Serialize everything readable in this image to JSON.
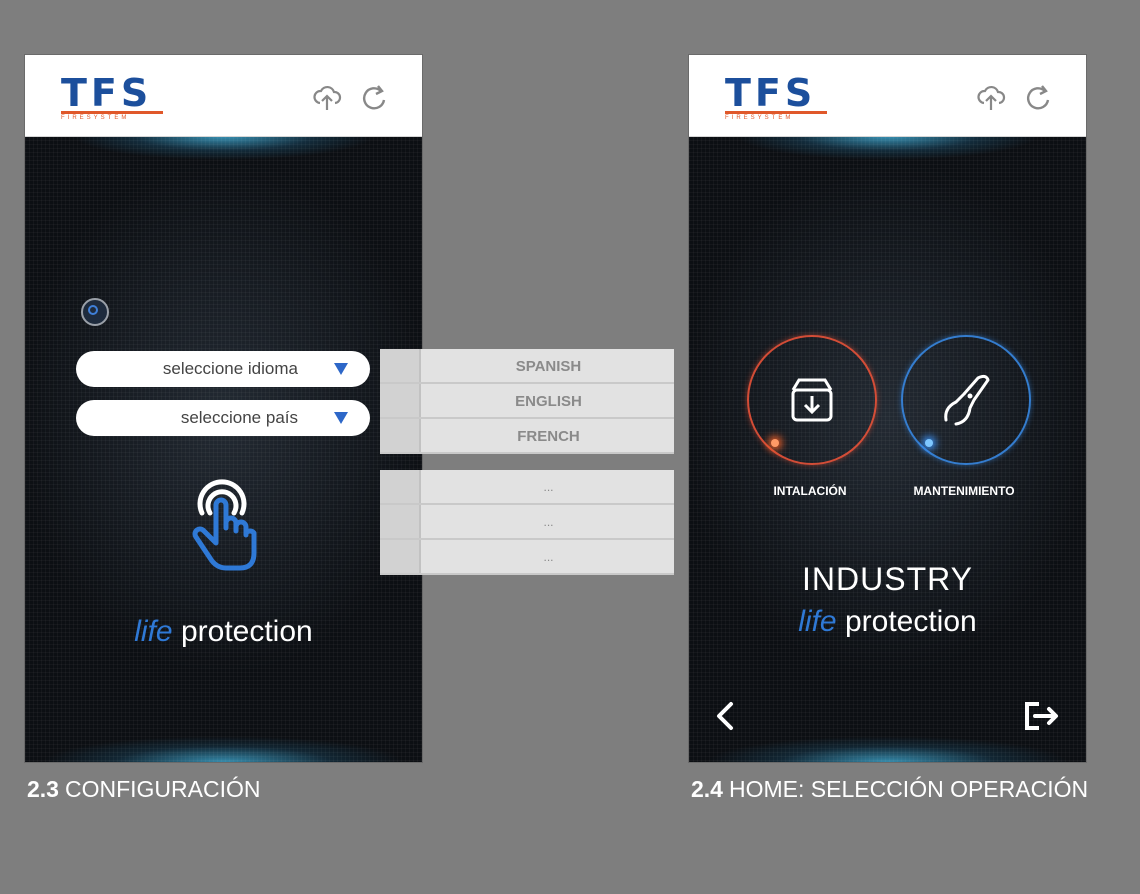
{
  "header": {
    "logo_text": "TFS",
    "logo_sub": "FIRESYSTEM"
  },
  "screen_config": {
    "language_select": "seleccione idioma",
    "country_select": "seleccione país",
    "tagline_life": "life",
    "tagline_protection": "protection",
    "caption_number": "2.3",
    "caption_text": "CONFIGURACIÓN"
  },
  "dropdown_languages": [
    "SPANISH",
    "ENGLISH",
    "FRENCH"
  ],
  "dropdown_countries": [
    "...",
    "...",
    "..."
  ],
  "screen_home": {
    "install_label": "INTALACIÓN",
    "maintenance_label": "MANTENIMIENTO",
    "industry": "INDUSTRY",
    "tagline_life": "life",
    "tagline_protection": "protection",
    "caption_number": "2.4",
    "caption_text": "HOME: SELECCIÓN OPERACIÓN"
  },
  "colors": {
    "brand_blue": "#1c4f9c",
    "brand_orange": "#e0582a",
    "accent_blue": "#2f79d6",
    "install_ring": "#e85238",
    "maintenance_ring": "#3787e1"
  }
}
